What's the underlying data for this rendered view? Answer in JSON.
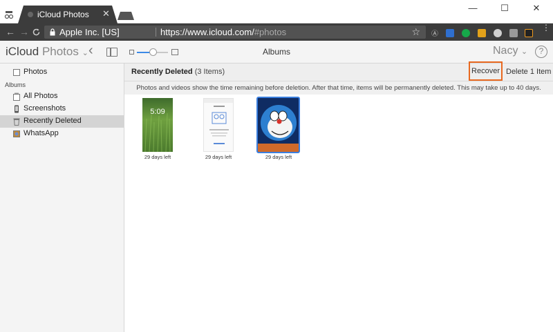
{
  "browser": {
    "tab_title": "iCloud Photos",
    "tab_close": "✕",
    "window_controls": {
      "minimize": "—",
      "maximize": "☐",
      "close": "✕"
    },
    "nav": {
      "back": "←",
      "forward": "→",
      "reload": "C"
    },
    "site_identity": "Apple Inc. [US]",
    "url_main": "https://www.icloud.com/",
    "url_hash": "#photos",
    "bookmark_star": "☆",
    "extension_icons": [
      "translate-icon",
      "shield-icon",
      "grammarly-icon",
      "puzzle-icon",
      "settings-icon",
      "image-icon",
      "amazon-icon",
      "menu-dots-icon"
    ]
  },
  "header": {
    "brand": "iCloud",
    "app_name": "Photos",
    "app_chevron": "⌄",
    "back_icon": "‹",
    "section_title": "Albums",
    "user_name": "Nacy",
    "user_chevron": "⌄",
    "help": "?"
  },
  "zoom": {
    "value": 0.5
  },
  "sidebar": {
    "top_item": "Photos",
    "albums_header": "Albums",
    "items": [
      {
        "label": "All Photos",
        "icon": "photos-stack-icon"
      },
      {
        "label": "Screenshots",
        "icon": "phone-icon"
      },
      {
        "label": "Recently Deleted",
        "icon": "trash-icon"
      },
      {
        "label": "WhatsApp",
        "icon": "whatsapp-album-icon"
      }
    ],
    "active_index": 2
  },
  "main": {
    "title": "Recently Deleted",
    "count": "(3 Items)",
    "recover_label": "Recover",
    "delete_label": "Delete 1 Item",
    "notice": "Photos and videos show the time remaining before deletion. After that time, items will be permanently deleted. This may take up to 40 days.",
    "items": [
      {
        "caption": "29 days left",
        "kind": "lockscreen",
        "clock": "5:09"
      },
      {
        "caption": "29 days left",
        "kind": "app-screenshot"
      },
      {
        "caption": "29 days left",
        "kind": "photo",
        "selected": true
      }
    ]
  },
  "colors": {
    "accent": "#3b89e6",
    "highlight": "#e8681f",
    "browser_dark": "#3c3c3c"
  }
}
